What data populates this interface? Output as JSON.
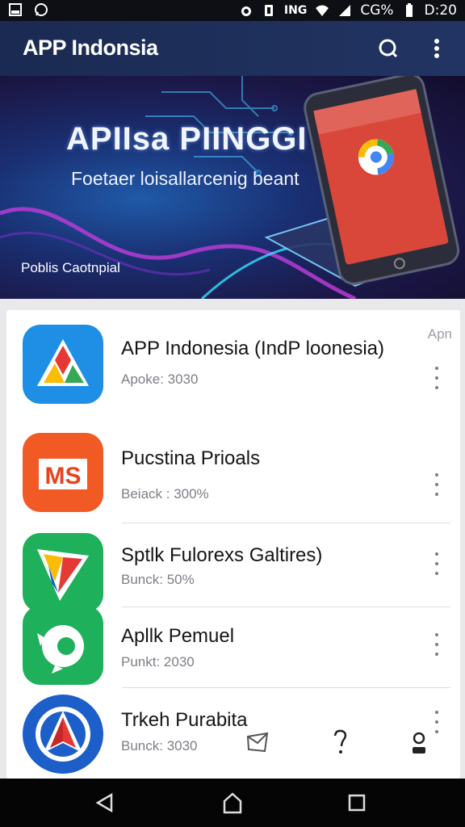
{
  "status_bar": {
    "left_icons": [
      "gallery-icon",
      "whatsapp-icon"
    ],
    "right_icons": [
      "alarm-icon",
      "vibrate-icon",
      "signal-icon",
      "wifi-icon",
      "battery-icon"
    ],
    "network_label": "ING",
    "battery_text": "CG%",
    "time": "D:20"
  },
  "app_bar": {
    "title": "APP Indonsia",
    "actions": [
      "search-icon",
      "overflow-menu-icon"
    ]
  },
  "banner": {
    "title": "APIIsa PIINGGI",
    "subtitle": "Foetaer loisallarcenig beant",
    "caption": "Poblis Caotnpial"
  },
  "list": {
    "corner_label": "Apn",
    "apps": [
      {
        "name": "APP Indonesia (IndP loonesia)",
        "meta": "Apoke: 3030",
        "icon": "triangle-logo-icon",
        "icon_color": "#1f8fe6"
      },
      {
        "name": "Pucstina Prioals",
        "meta": "Beiack : 300%",
        "icon": "ms-logo-icon",
        "icon_color": "#f15a24"
      },
      {
        "name": "Sptlk Fulorexs Galtires)",
        "meta": "Bunck: 50%",
        "icon": "play-logo-icon",
        "icon_color": "#1fb05b"
      },
      {
        "name": "Apllk Pemuel",
        "meta": "Punkt: 2030",
        "icon": "gear-bird-logo-icon",
        "icon_color": "#1fb05b"
      },
      {
        "name": "Trkeh Purabita",
        "meta": "Bunck: 3030",
        "icon": "arrow-logo-icon",
        "icon_color": "#1c5fc8"
      }
    ]
  },
  "bottom_overlay_icons": [
    "mail-icon",
    "help-icon",
    "account-icon"
  ],
  "nav_bar": [
    "back-icon",
    "home-icon",
    "recents-icon"
  ],
  "colors": {
    "app_bar": "#1d2d58",
    "status_bar": "#0d0f14",
    "nav_bar": "#050506"
  }
}
